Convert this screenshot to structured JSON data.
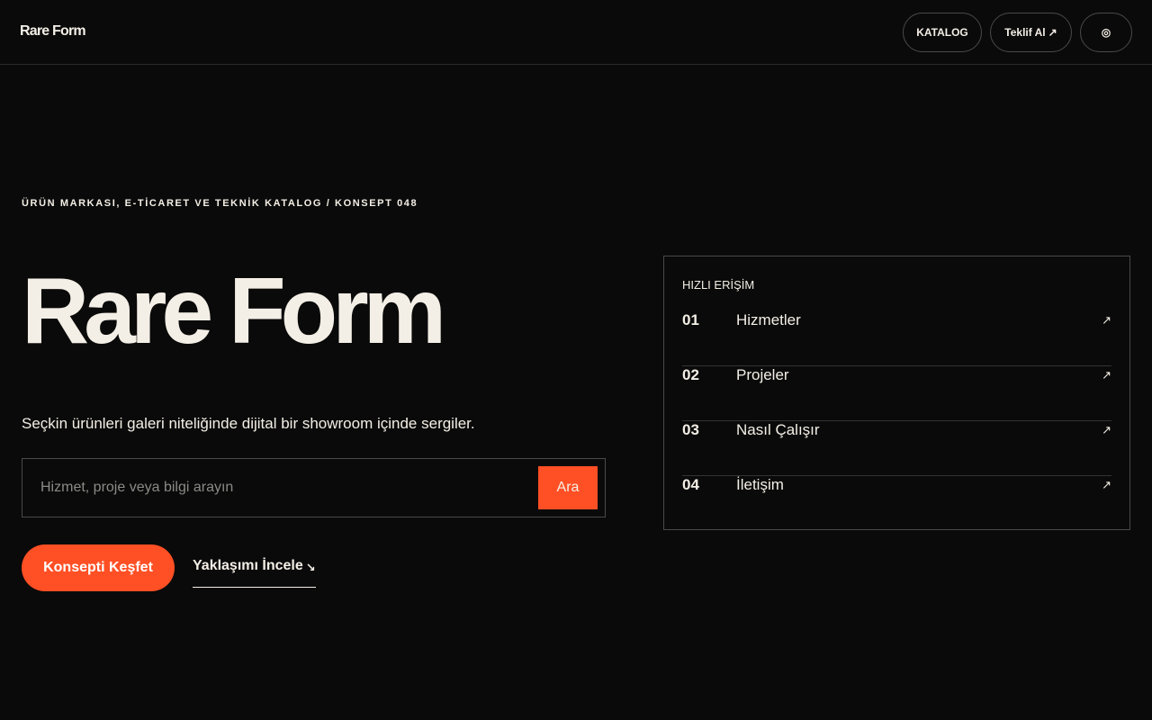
{
  "header": {
    "logo": "Rare Form",
    "catalog_label": "KATALOG",
    "quote_label": "Teklif Al",
    "quote_icon": "↗",
    "circle_icon": "◎"
  },
  "hero": {
    "kicker": "ÜRÜN MARKASI, E-TİCARET VE TEKNİK KATALOG / KONSEPT 048",
    "title": "Rare Form",
    "subtitle": "Seçkin ürünleri galeri niteliğinde dijital bir showroom içinde sergiler.",
    "search": {
      "placeholder": "Hizmet, proje veya bilgi arayın",
      "value": "",
      "button_label": "Ara"
    },
    "cta_label": "Konsepti Keşfet",
    "secondary_label": "Yaklaşımı İncele",
    "secondary_icon": "↘"
  },
  "quick_access": {
    "label": "HIZLI ERİŞİM",
    "items": [
      {
        "num": "01",
        "label": "Hizmetler",
        "icon": "↗"
      },
      {
        "num": "02",
        "label": "Projeler",
        "icon": "↗"
      },
      {
        "num": "03",
        "label": "Nasıl Çalışır",
        "icon": "↗"
      },
      {
        "num": "04",
        "label": "İletişim",
        "icon": "↗"
      }
    ]
  },
  "colors": {
    "background": "#0a0a0a",
    "text": "#f4efe6",
    "accent": "#ff4f24",
    "border": "#4a4a4a"
  }
}
